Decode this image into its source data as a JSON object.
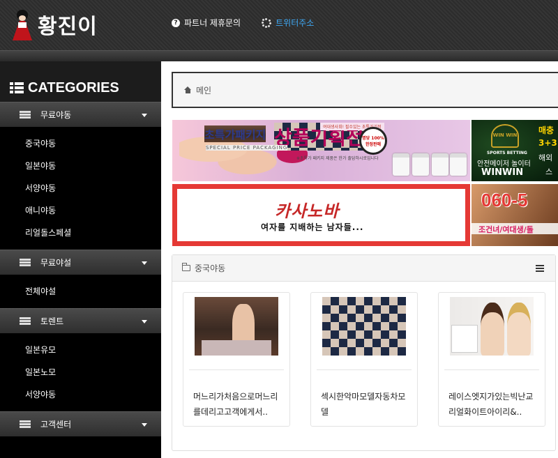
{
  "header": {
    "logo_text": "황진이",
    "nav": [
      {
        "label": "파트너 제휴문의",
        "icon": "question-circle-icon"
      },
      {
        "label": "트위터주소",
        "icon": "spinner-icon",
        "color": "#3fa9f5"
      }
    ]
  },
  "sidebar": {
    "title": "CATEGORIES",
    "sections": [
      {
        "label": "무료야동",
        "items": [
          "중국야동",
          "일본야동",
          "서양야동",
          "애니야동",
          "리얼돌스페셜"
        ]
      },
      {
        "label": "무료야설",
        "items": [
          "전체야설"
        ]
      },
      {
        "label": "토렌트",
        "items": [
          "일본유모",
          "일본노모",
          "서양야동"
        ]
      },
      {
        "label": "고객센터",
        "items": []
      }
    ]
  },
  "breadcrumb": {
    "home": "메인"
  },
  "banners": {
    "b1": {
      "headline_a": "초특가패키지",
      "headline_b": "상품기획전!",
      "sub": "SPECIAL PRICE PACKAGING",
      "note": "※초특가 패키지 제품은 한가 출담하시로입니다",
      "badge": "여대생사회! 필수있는 초특가기적",
      "clock": "명당 100% 한정판매"
    },
    "b2": {
      "win": "WIN WIN",
      "sports": "SPORTS BETTING",
      "safe": "안전메이저 놀이터",
      "brand": "WINWIN",
      "side1": "매충",
      "side2": "3+3",
      "side3": "해외",
      "side4": "스"
    },
    "b3": {
      "title": "카사노바",
      "sub": "여자를 지배하는 남자들..."
    },
    "b4": {
      "number": "060-5",
      "bar": "조건녀/여대생/돌"
    }
  },
  "panel": {
    "title": "중국야동",
    "cards": [
      {
        "title": "머느리가처음으로머느리를데리고고객에게서.."
      },
      {
        "title": "섹시한악마모델자동차모델"
      },
      {
        "title": "레이스엣지가있는빅난교리얼화이트아이리&.."
      }
    ]
  },
  "colors": {
    "accent_blue": "#3fa9f5",
    "banner_red": "#e53935",
    "header_dark": "#2c2c2c"
  }
}
